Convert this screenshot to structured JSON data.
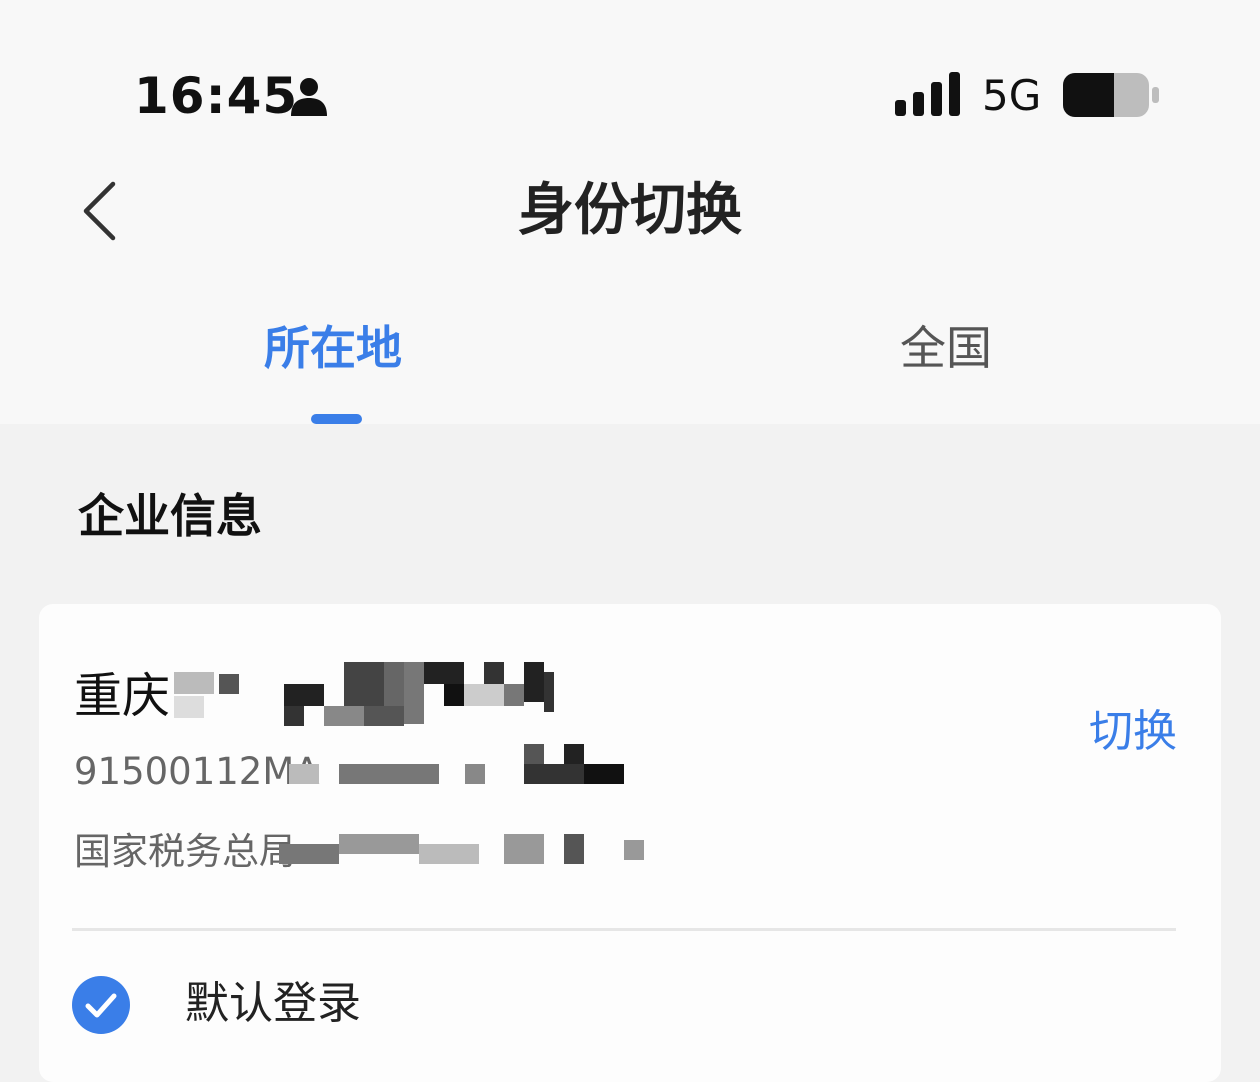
{
  "status_bar": {
    "time": "16:45",
    "network": "5G",
    "icons": [
      "person-icon",
      "signal-icon",
      "battery-icon"
    ]
  },
  "nav": {
    "title": "身份切换",
    "back_icon": "chevron-left-icon"
  },
  "tabs": [
    {
      "label": "所在地",
      "active": true
    },
    {
      "label": "全国",
      "active": false
    }
  ],
  "section": {
    "title": "企业信息"
  },
  "card": {
    "company_name": "重庆",
    "tax_id": "91500112MA",
    "tax_office": "国家税务总局",
    "switch_label": "切换",
    "default_login_label": "默认登录",
    "default_login_checked": true
  },
  "colors": {
    "accent": "#3a7ee8",
    "background": "#f2f2f2",
    "header_background": "#f8f8f8",
    "card_background": "#fdfdfd"
  }
}
